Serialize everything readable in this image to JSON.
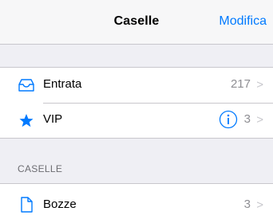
{
  "navbar": {
    "title": "Caselle",
    "edit_label": "Modifica"
  },
  "mailboxes": [
    {
      "label": "Entrata",
      "count": "217",
      "chevron": ">",
      "icon": "inbox-tray-icon"
    },
    {
      "label": "VIP",
      "count": "3",
      "chevron": ">",
      "icon": "star-icon",
      "info_icon": "info-icon"
    }
  ],
  "section_header": "CASELLE",
  "folders": [
    {
      "label": "Bozze",
      "count": "3",
      "chevron": ">",
      "icon": "draft-document-icon"
    }
  ],
  "colors": {
    "accent": "#007aff",
    "secondary_text": "#8e8e93",
    "separator": "#c8c7cc",
    "background": "#efeff4"
  }
}
